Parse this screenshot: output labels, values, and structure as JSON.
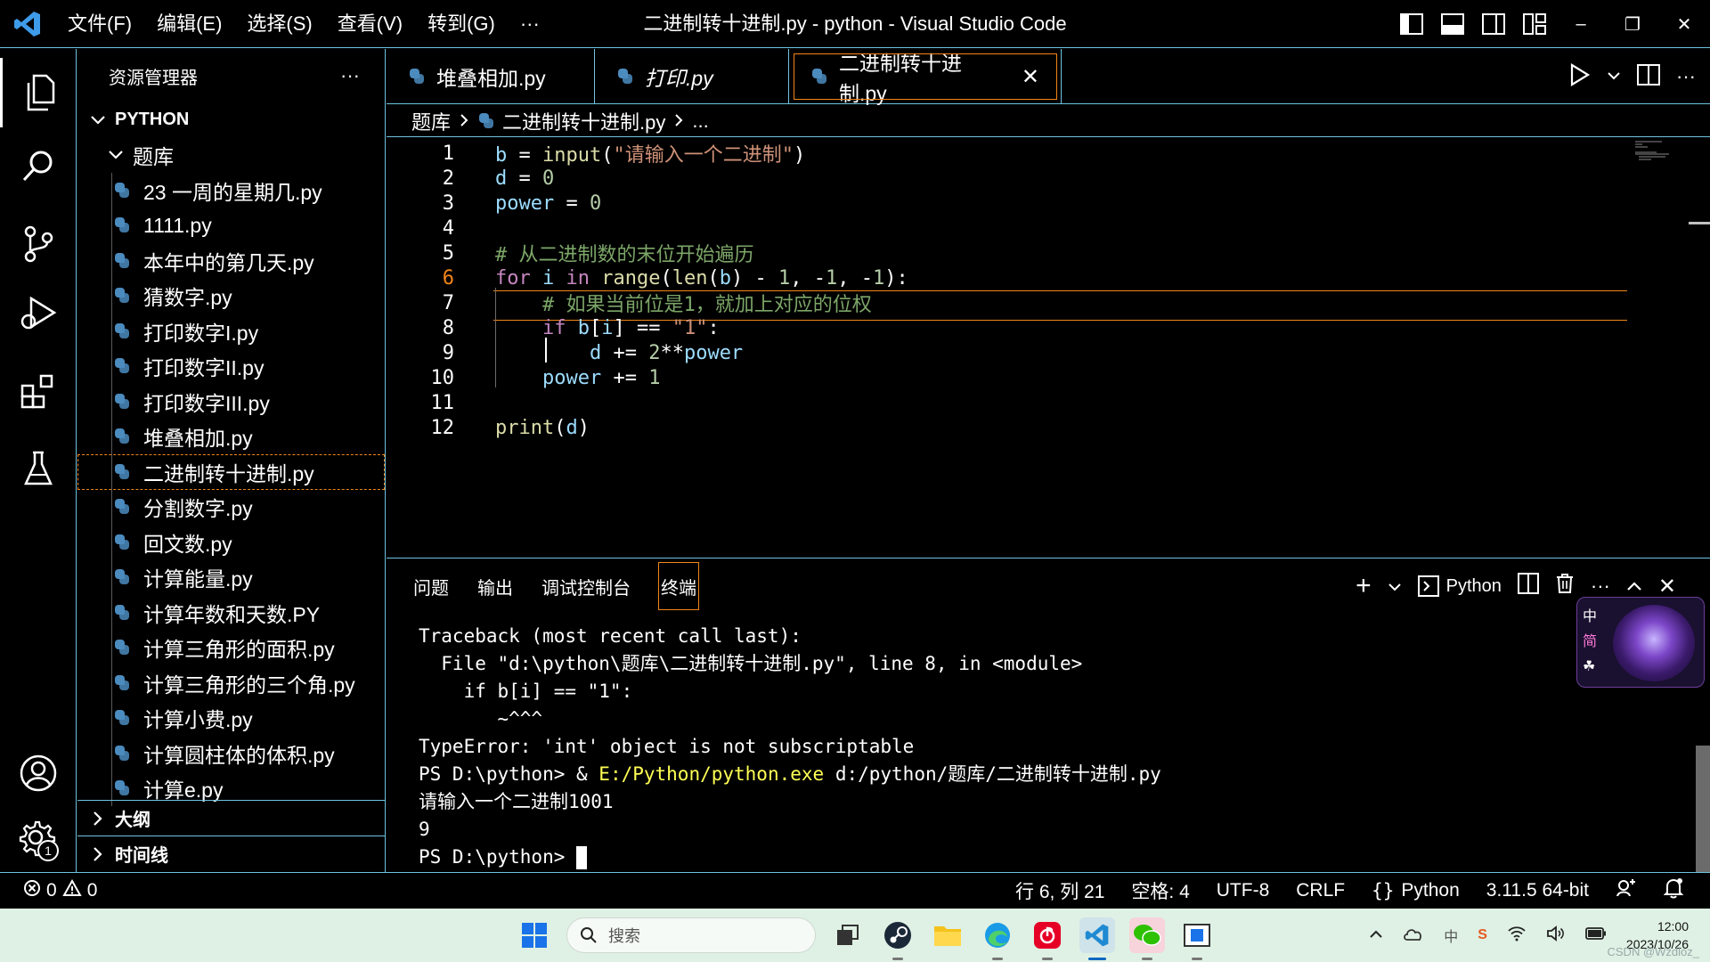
{
  "window": {
    "title": "二进制转十进制.py - python - Visual Studio Code",
    "menu": [
      "文件(F)",
      "编辑(E)",
      "选择(S)",
      "查看(V)",
      "转到(G)",
      "···"
    ]
  },
  "explorer": {
    "title": "资源管理器",
    "more": "···",
    "root": "PYTHON",
    "folder": "题库",
    "files": [
      "23 一周的星期几.py",
      "1111.py",
      "本年中的第几天.py",
      "猜数字.py",
      "打印数字I.py",
      "打印数字II.py",
      "打印数字III.py",
      "堆叠相加.py",
      "二进制转十进制.py",
      "分割数字.py",
      "回文数.py",
      "计算能量.py",
      "计算年数和天数.PY",
      "计算三角形的面积.py",
      "计算三角形的三个角.py",
      "计算小费.py",
      "计算圆柱体的体积.py",
      "计算e.py"
    ],
    "selected_index": 8,
    "outline": "大纲",
    "timeline": "时间线"
  },
  "tabs": [
    {
      "label": "堆叠相加.py",
      "italic": false
    },
    {
      "label": "打印.py",
      "italic": true
    },
    {
      "label": "二进制转十进制.py",
      "italic": false,
      "active": true
    }
  ],
  "breadcrumb": {
    "folder": "题库",
    "file": "二进制转十进制.py",
    "more": "..."
  },
  "editor": {
    "current_line": 6,
    "line_numbers": [
      "1",
      "2",
      "3",
      "4",
      "5",
      "6",
      "7",
      "8",
      "9",
      "10",
      "11",
      "12"
    ]
  },
  "panel": {
    "tabs": [
      "问题",
      "输出",
      "调试控制台",
      "终端"
    ],
    "active_tab": "终端",
    "terminal_profile": "Python",
    "terminal_lines": [
      "Traceback (most recent call last):",
      "  File \"d:\\python\\题库\\二进制转十进制.py\", line 8, in <module>",
      "    if b[i] == \"1\":",
      "       ~^^^",
      "TypeError: 'int' object is not subscriptable"
    ],
    "prompt_prefix": "PS D:\\python> & ",
    "prompt_exe": "E:/Python/python.exe",
    "prompt_arg": " d:/python/题库/二进制转十进制.py",
    "input_line": "请输入一个二进制1001",
    "output_line": "9",
    "last_prompt": "PS D:\\python> "
  },
  "ime": {
    "mode1": "中",
    "mode2": "简"
  },
  "statusbar": {
    "errors": "0",
    "warnings": "0",
    "position": "行 6, 列 21",
    "spaces": "空格: 4",
    "encoding": "UTF-8",
    "eol": "CRLF",
    "language": "Python",
    "interpreter": "3.11.5 64-bit"
  },
  "settings_badge": "1",
  "taskbar": {
    "search_placeholder": "搜索",
    "time": "12:00",
    "date": "2023/10/26",
    "watermark": "CSDN @Wzdloz_"
  },
  "colors": {
    "accent_border": "#6fc3df",
    "focus_orange": "#f38518",
    "taskbar_bg": "#dff1e4"
  }
}
